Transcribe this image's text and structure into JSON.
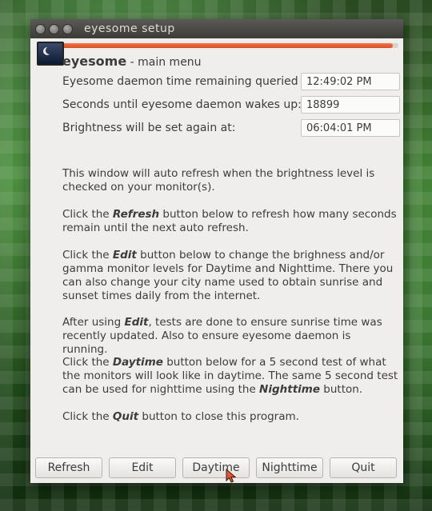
{
  "window": {
    "title": "eyesome setup",
    "progress_fraction": 0.985
  },
  "header": {
    "app_name": "eyesome",
    "subtitle": " - main menu"
  },
  "fields": [
    {
      "label": "Eyesome daemon time remaining queried at:",
      "value": "12:49:02 PM"
    },
    {
      "label": "Seconds until eyesome daemon wakes up:",
      "value": "18899"
    },
    {
      "label": "Brightness will be set again at:",
      "value": "06:04:01 PM"
    }
  ],
  "info": {
    "p1": "This window will auto refresh when the brightness level is checked on your monitor(s).",
    "p2_pre": "Click the ",
    "p2_em": "Refresh",
    "p2_post": " button below to refresh how many seconds remain until the next auto refresh.",
    "p3_pre": "Click the ",
    "p3_em": "Edit",
    "p3_post": " button below to change the brighness and/or gamma monitor levels for Daytime and Nighttime. There you can also change your city name used to obtain sunrise and sunset times daily from the internet.",
    "p4_pre": "After using ",
    "p4_em": "Edit",
    "p4_post": ", tests are done to ensure sunrise time was recently updated. Also to ensure eyesome daemon is running.",
    "p5_pre": "Click the ",
    "p5_em": "Daytime",
    "p5_mid": " button below for a 5 second test of what the monitors will look like in daytime. The same 5 second test can be used for nighttime using the ",
    "p5_em2": "Nighttime",
    "p5_post": " button.",
    "p6_pre": "Click the ",
    "p6_em": "Quit",
    "p6_post": " button to close this program."
  },
  "buttons": {
    "refresh": "Refresh",
    "edit": "Edit",
    "daytime": "Daytime",
    "nighttime": "Nighttime",
    "quit": "Quit"
  }
}
